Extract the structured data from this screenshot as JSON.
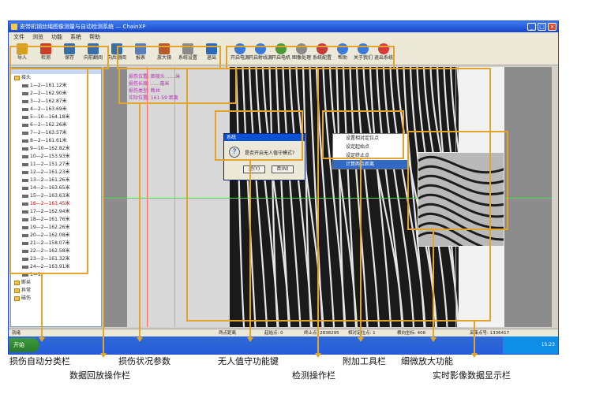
{
  "window": {
    "title": "皮带机钢丝绳图像测量与自动检测系统 — ChainXP",
    "minimize": "_",
    "maximize": "□",
    "close": "×"
  },
  "menu": [
    "文件",
    "浏览",
    "功能",
    "系统",
    "帮助"
  ],
  "toolbar_left": [
    {
      "label": "导入",
      "icon": "import-icon",
      "color": "#d8a020"
    },
    {
      "label": "检测",
      "icon": "detect-icon",
      "color": "#c8402a"
    },
    {
      "label": "保存",
      "icon": "save-icon",
      "color": "#3a6ea8"
    },
    {
      "label": "向前翻阅",
      "icon": "back-icon",
      "color": "#3a6ea8"
    },
    {
      "label": "向后翻阅",
      "icon": "forward-icon",
      "color": "#3a6ea8"
    },
    {
      "label": "报表",
      "icon": "report-icon",
      "color": "#5a7fb8"
    },
    {
      "label": "放大镜",
      "icon": "magnifier-icon",
      "color": "#b85a2a"
    },
    {
      "label": "系统设置",
      "icon": "settings-icon",
      "color": "#8a8a8a"
    },
    {
      "label": "退出",
      "icon": "exit-icon",
      "color": "#2a6ab8"
    }
  ],
  "toolbar_right": [
    {
      "label": "开启电源",
      "icon": "power-icon",
      "color": "#3a7ad8"
    },
    {
      "label": "开启射线源",
      "icon": "ray-icon",
      "color": "#3a7ad8"
    },
    {
      "label": "开启电机",
      "icon": "motor-icon",
      "color": "#4a9a3a"
    },
    {
      "label": "图像处理",
      "icon": "image-icon",
      "color": "#8a8a8a"
    },
    {
      "label": "系统配置",
      "icon": "config-icon",
      "color": "#c83a3a"
    },
    {
      "label": "帮助",
      "icon": "help-icon",
      "color": "#3a7ad8"
    },
    {
      "label": "关于我们",
      "icon": "about-icon",
      "color": "#3a7ad8"
    },
    {
      "label": "退出系统",
      "icon": "quit-icon",
      "color": "#d83a3a"
    }
  ],
  "tree": {
    "root": "接头",
    "items": [
      "1—2—161.12米",
      "2—2—162.90米",
      "3—2—162.87米",
      "4—2—163.69米",
      "5—10—164.18米",
      "6—2—162.26米",
      "7—2—163.57米",
      "8—2—161.61米",
      "9—10—162.82米",
      "10—2—153.93米",
      "11—2—151.27米",
      "12—2—161.23米",
      "13—2—161.26米",
      "14—2—163.65米",
      "15—2—163.63米",
      "16—2—163.45米",
      "17—2—162.94米",
      "18—2—161.76米",
      "19—2—162.26米",
      "20—2—162.08米",
      "21—2—158.07米",
      "22—2—162.58米",
      "23—2—161.32米",
      "24—2—163.91米"
    ],
    "selected_index": 15,
    "last": "1—1",
    "folders": [
      "断丝",
      "异常",
      "磁伤"
    ]
  },
  "params": {
    "lines": [
      "损伤位置: 距接头 ......米",
      "损伤长度: ......毫米",
      "损伤类型: 断丝",
      "实际位置: 161.59 距离"
    ]
  },
  "dialog": {
    "title": "系统",
    "message": "是否开启无人值守模式?",
    "yes": "是(Y)",
    "no": "否(N)"
  },
  "context_menu": {
    "items": [
      "设置相对定位点",
      "设定起始点",
      "设定终止点",
      "计算两点距离"
    ],
    "highlight_index": 3
  },
  "status": {
    "ready": "就绪",
    "two_points": "两点距离",
    "start": "起始点: 0",
    "end": "终止点: 2838295",
    "relative": "相对定位点: 1",
    "horizontal": "横向坐标: 408",
    "collection": "采集点号: 1336417"
  },
  "taskbar": {
    "start": "开始",
    "time": "15:23"
  },
  "callouts": {
    "auto_classify": "损伤自动分类栏",
    "playback": "数据回放操作栏",
    "damage_params": "损伤状况参数",
    "unattended": "无人值守功能键",
    "detect": "检测操作栏",
    "extra_tools": "附加工具栏",
    "zoom": "细微放大功能",
    "realtime": "实时影像数据显示栏"
  },
  "colors": {
    "accent": "#e4a32a",
    "title_bar": "#1846c8",
    "param_text": "#b12db1",
    "menu_highlight": "#316ac5"
  }
}
